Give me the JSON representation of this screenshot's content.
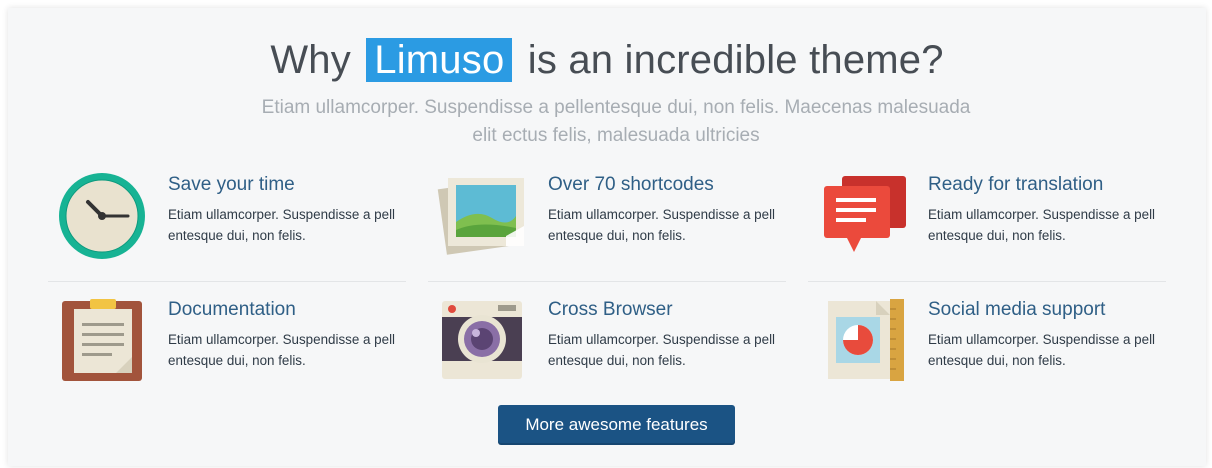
{
  "heading": {
    "prefix": "Why",
    "highlight": "Limuso",
    "suffix": "is an incredible theme?"
  },
  "subtitle": "Etiam ullamcorper. Suspendisse a pellentesque dui, non felis. Maecenas malesuada elit ectus felis, malesuada ultricies",
  "features": [
    {
      "icon": "clock-icon",
      "title": "Save your time",
      "desc": "Etiam ullamcorper. Suspendisse a pell entesque dui, non felis."
    },
    {
      "icon": "picture-icon",
      "title": "Over 70 shortcodes",
      "desc": "Etiam ullamcorper. Suspendisse a pell entesque dui, non felis."
    },
    {
      "icon": "speech-bubble-icon",
      "title": "Ready for translation",
      "desc": "Etiam ullamcorper. Suspendisse a pell entesque dui, non felis."
    },
    {
      "icon": "clipboard-icon",
      "title": "Documentation",
      "desc": "Etiam ullamcorper. Suspendisse a pell entesque dui, non felis."
    },
    {
      "icon": "camera-icon",
      "title": "Cross Browser",
      "desc": "Etiam ullamcorper. Suspendisse a pell entesque dui, non felis."
    },
    {
      "icon": "pie-chart-document-icon",
      "title": "Social media support",
      "desc": "Etiam ullamcorper. Suspendisse a pell entesque dui, non felis."
    }
  ],
  "cta_label": "More awesome features",
  "colors": {
    "highlight": "#2b9be3",
    "title": "#2f5f86",
    "button": "#1b5384"
  }
}
